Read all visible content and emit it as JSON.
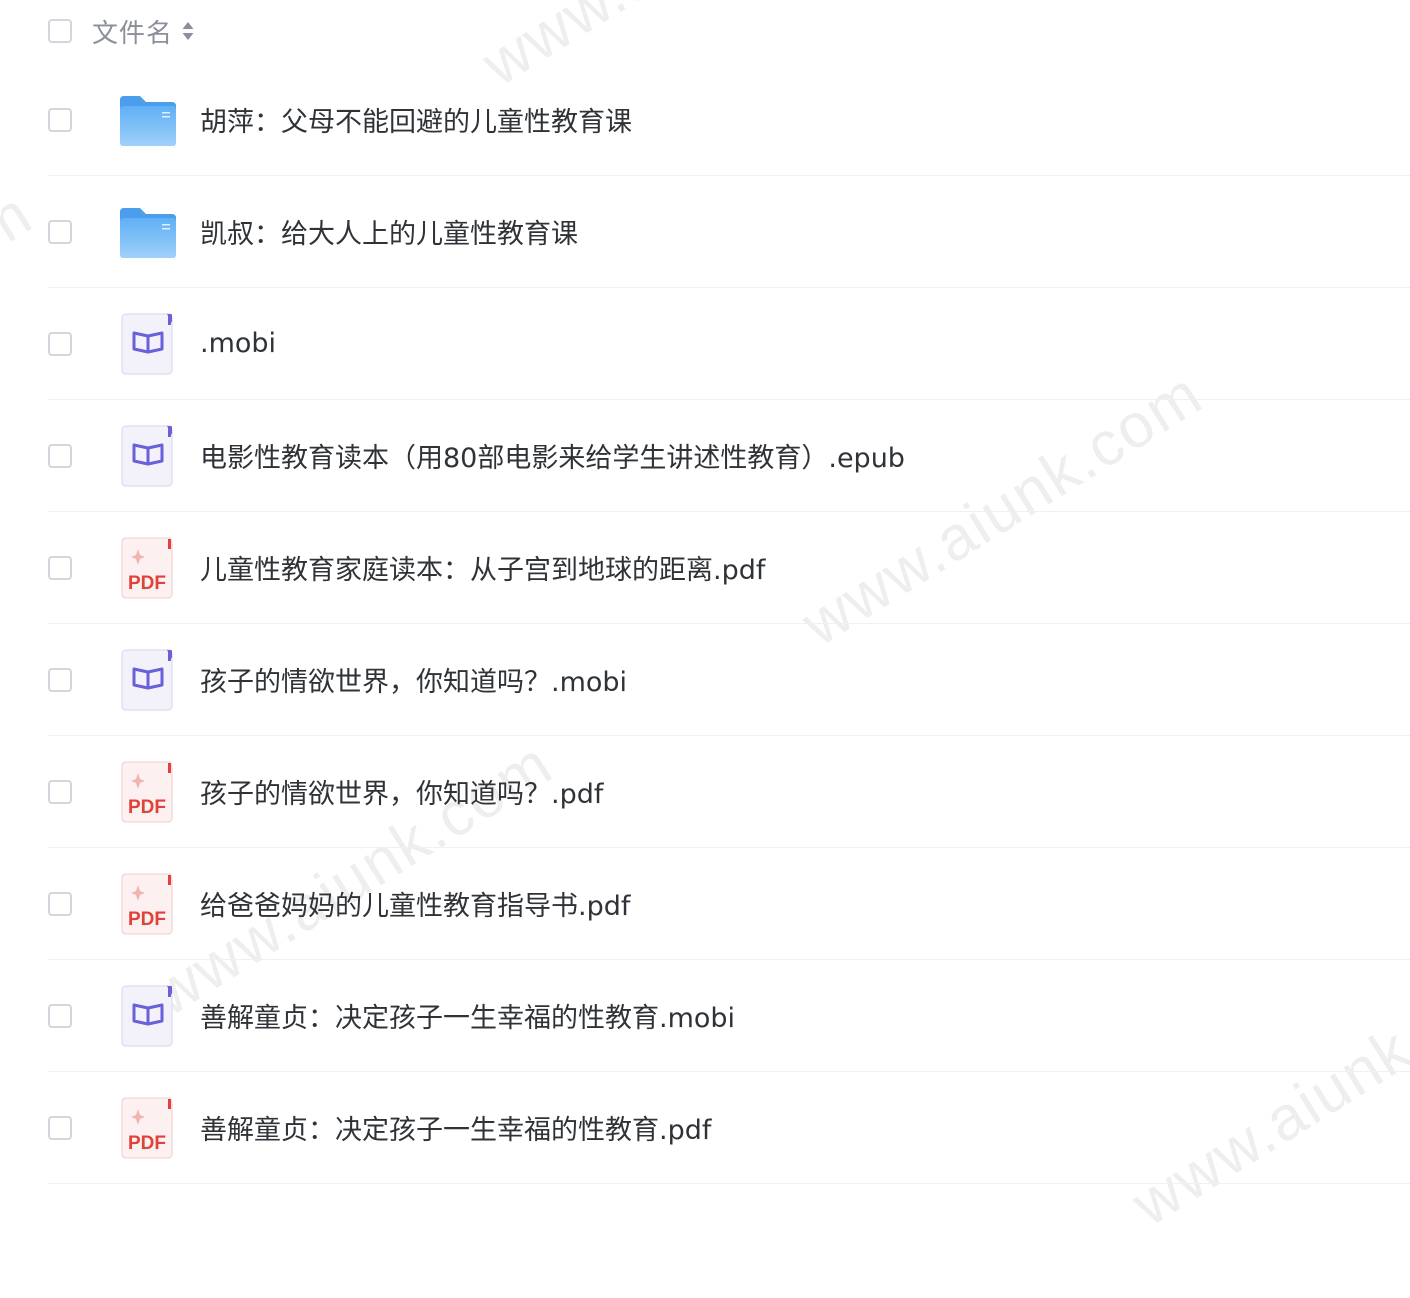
{
  "header": {
    "label": "文件名",
    "sort_icon": "sort-updown-icon"
  },
  "files": [
    {
      "name": "胡萍：父母不能回避的儿童性教育课",
      "type": "folder"
    },
    {
      "name": "凯叔：给大人上的儿童性教育课",
      "type": "folder"
    },
    {
      "name": ".mobi",
      "type": "ebook"
    },
    {
      "name": "电影性教育读本（用80部电影来给学生讲述性教育）.epub",
      "type": "ebook"
    },
    {
      "name": "儿童性教育家庭读本：从子宫到地球的距离.pdf",
      "type": "pdf"
    },
    {
      "name": "孩子的情欲世界，你知道吗？.mobi",
      "type": "ebook"
    },
    {
      "name": "孩子的情欲世界，你知道吗？.pdf",
      "type": "pdf"
    },
    {
      "name": "给爸爸妈妈的儿童性教育指导书.pdf",
      "type": "pdf"
    },
    {
      "name": "善解童贞：决定孩子一生幸福的性教育.mobi",
      "type": "ebook"
    },
    {
      "name": "善解童贞：决定孩子一生幸福的性教育.pdf",
      "type": "pdf"
    }
  ],
  "icons": {
    "folder": "folder-icon",
    "ebook": "ebook-icon",
    "pdf": "pdf-icon",
    "pdf_text": "PDF"
  },
  "watermark": "www.aiunk.com",
  "colors": {
    "folder": "#5aa9f2",
    "ebook": "#6a60d9",
    "pdf": "#e0413a",
    "divider": "#eef0f3"
  }
}
